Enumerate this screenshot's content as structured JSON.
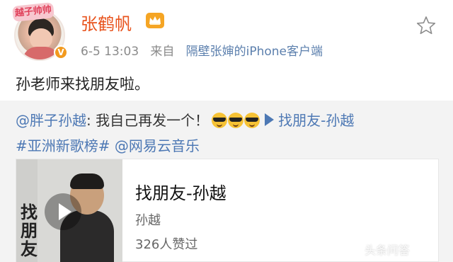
{
  "post": {
    "username": "张鹤帆",
    "date": "6-5 13:03",
    "from_label": "来自",
    "source": "隔壁张婶的iPhone客户端",
    "text": "孙老师来找朋友啦。",
    "avatar_tag": "越子帅帅"
  },
  "repost": {
    "mention": "@胖子孙越",
    "body": ": 我自己再发一个！",
    "song_link": "找朋友-孙越",
    "hashtag": "#亚洲新歌榜#",
    "mention2": "@网易云音乐"
  },
  "music_card": {
    "title": "找朋友-孙越",
    "artist": "孙越",
    "likes": "326人赞过",
    "cover_text": "找朋友"
  },
  "watermark": "头条问答",
  "colors": {
    "username": "#e8531d",
    "link": "#4d78b4",
    "vip_badge": "#f5a524"
  },
  "icons": [
    "star-outline-icon",
    "vip-crown-icon",
    "verified-v-icon",
    "play-icon",
    "sunglasses-emoji-icon"
  ]
}
